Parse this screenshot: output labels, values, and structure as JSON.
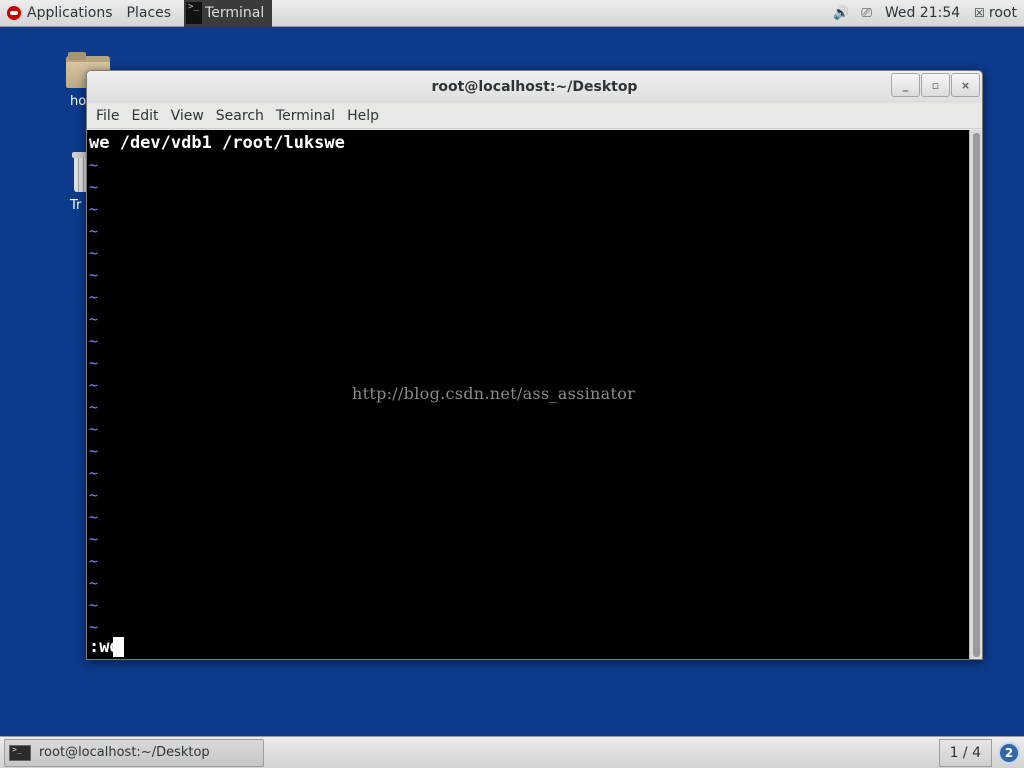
{
  "top_panel": {
    "applications": "Applications",
    "places": "Places",
    "active_app": "Terminal",
    "clock": "Wed 21:54",
    "user": "root",
    "icons": {
      "volume": "volume-icon",
      "network": "network-icon",
      "user": "user-icon"
    }
  },
  "desktop": {
    "icons": [
      {
        "label": "ho",
        "icon": "home-folder-icon"
      },
      {
        "label": "Tr",
        "icon": "trash-icon"
      }
    ]
  },
  "window": {
    "title": "root@localhost:~/Desktop",
    "buttons": {
      "minimize": "_",
      "maximize": "▫",
      "close": "×"
    },
    "menu": [
      "File",
      "Edit",
      "View",
      "Search",
      "Terminal",
      "Help"
    ]
  },
  "terminal": {
    "line1": "we /dev/vdb1 /root/lukswe",
    "tilde": "~",
    "tilde_count": 22,
    "command": ":wq",
    "watermark": "http://blog.csdn.net/ass_assinator"
  },
  "bottom_panel": {
    "task_label": "root@localhost:~/Desktop",
    "workspace": "1 / 4",
    "notifications": "2"
  },
  "colors": {
    "desktop_bg": "#0d3a8a",
    "terminal_bg": "#000000",
    "tilde": "#6e8ef5",
    "notification": "#3465a4"
  }
}
